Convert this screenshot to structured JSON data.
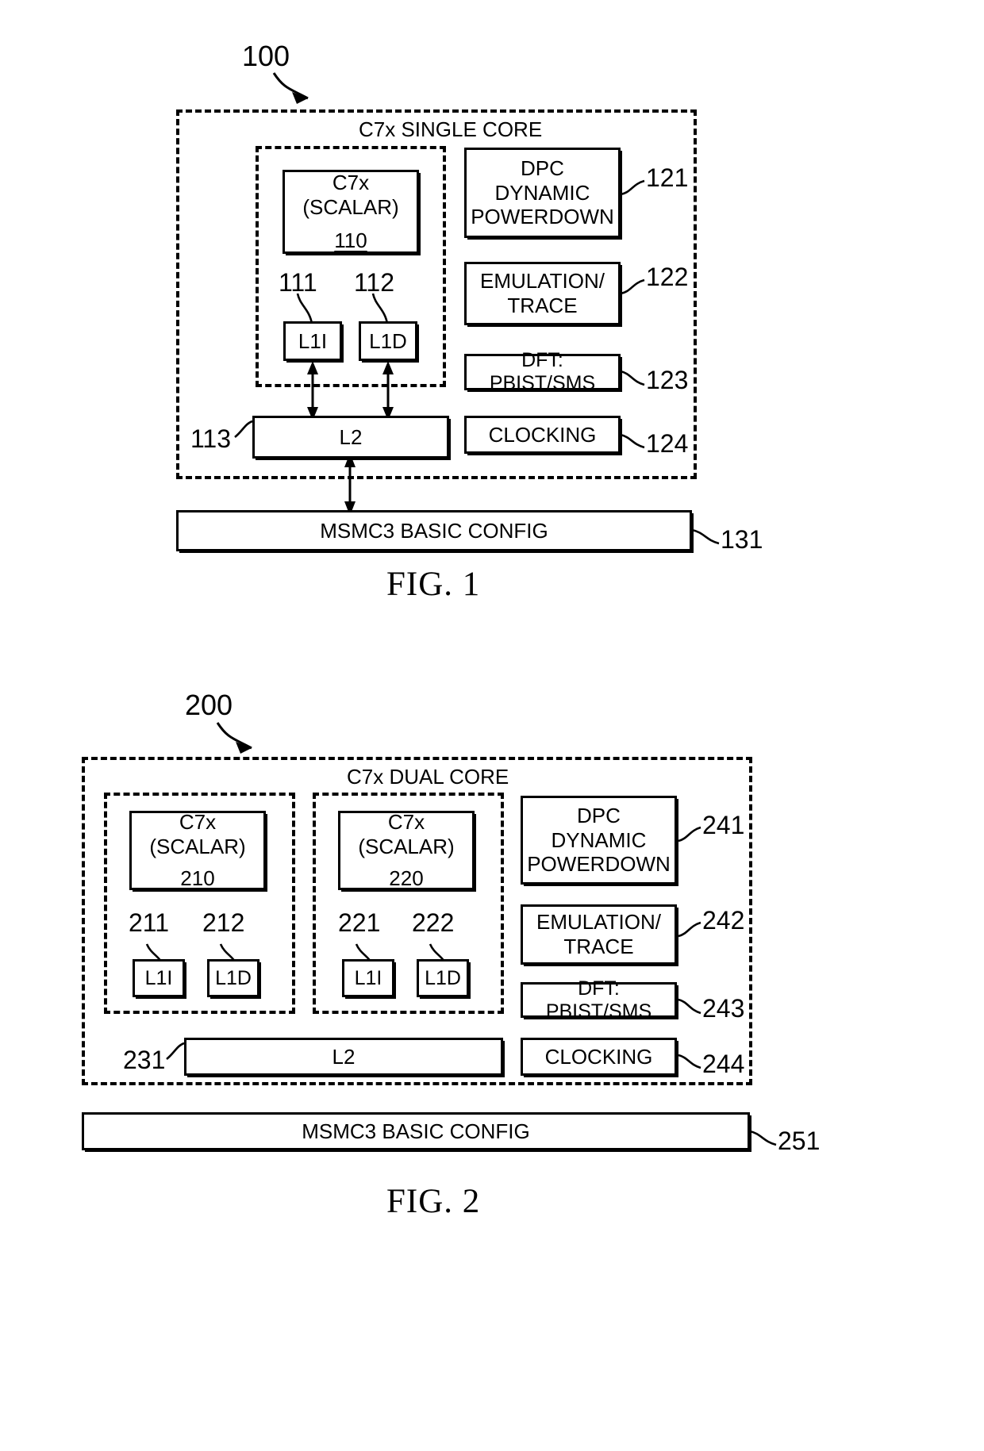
{
  "figures": [
    {
      "id": "fig1",
      "caption": "FIG. 1",
      "system_ref": "100",
      "outer_label": "C7x SINGLE CORE",
      "core": {
        "cpu_title": "C7x (SCALAR)",
        "cpu_ref": "110",
        "l1i_label": "L1I",
        "l1i_ref": "111",
        "l1d_label": "L1D",
        "l1d_ref": "112"
      },
      "l2": {
        "label": "L2",
        "ref": "113"
      },
      "peripherals": [
        {
          "label": "DPC\nDYNAMIC\nPOWERDOWN",
          "lines": [
            "DPC",
            "DYNAMIC",
            "POWERDOWN"
          ],
          "ref": "121"
        },
        {
          "label": "EMULATION/\nTRACE",
          "lines": [
            "EMULATION/",
            "TRACE"
          ],
          "ref": "122"
        },
        {
          "label": "DFT: PBIST/SMS",
          "lines": [
            "DFT: PBIST/SMS"
          ],
          "ref": "123"
        },
        {
          "label": "CLOCKING",
          "lines": [
            "CLOCKING"
          ],
          "ref": "124"
        }
      ],
      "msmc": {
        "label": "MSMC3 BASIC CONFIG",
        "ref": "131"
      }
    },
    {
      "id": "fig2",
      "caption": "FIG. 2",
      "system_ref": "200",
      "outer_label": "C7x DUAL CORE",
      "cores": [
        {
          "cpu_title": "C7x (SCALAR)",
          "cpu_ref": "210",
          "l1i_label": "L1I",
          "l1i_ref": "211",
          "l1d_label": "L1D",
          "l1d_ref": "212"
        },
        {
          "cpu_title": "C7x (SCALAR)",
          "cpu_ref": "220",
          "l1i_label": "L1I",
          "l1i_ref": "221",
          "l1d_label": "L1D",
          "l1d_ref": "222"
        }
      ],
      "l2": {
        "label": "L2",
        "ref": "231"
      },
      "peripherals": [
        {
          "label": "DPC\nDYNAMIC\nPOWERDOWN",
          "lines": [
            "DPC",
            "DYNAMIC",
            "POWERDOWN"
          ],
          "ref": "241"
        },
        {
          "label": "EMULATION/\nTRACE",
          "lines": [
            "EMULATION/",
            "TRACE"
          ],
          "ref": "242"
        },
        {
          "label": "DFT: PBIST/SMS",
          "lines": [
            "DFT: PBIST/SMS"
          ],
          "ref": "243"
        },
        {
          "label": "CLOCKING",
          "lines": [
            "CLOCKING"
          ],
          "ref": "244"
        }
      ],
      "msmc": {
        "label": "MSMC3 BASIC CONFIG",
        "ref": "251"
      }
    }
  ],
  "colors": {
    "ink": "#000000",
    "paper": "#ffffff"
  }
}
